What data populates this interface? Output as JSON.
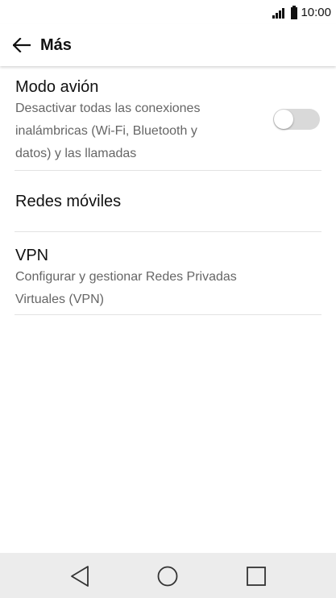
{
  "status_bar": {
    "time": "10:00"
  },
  "app_bar": {
    "title": "Más"
  },
  "settings": {
    "airplane": {
      "title": "Modo avión",
      "subtitle_lines": [
        "Desactivar todas las conexiones",
        "inalámbricas (Wi-Fi, Bluetooth y",
        "datos) y las llamadas"
      ],
      "enabled": false
    },
    "mobile_networks": {
      "title": "Redes móviles"
    },
    "vpn": {
      "title": "VPN",
      "subtitle_lines": [
        "Configurar y gestionar Redes Privadas",
        "Virtuales (VPN)"
      ]
    }
  },
  "colors": {
    "toggle_off": "#d9d9d9",
    "subtitle_text": "#666666",
    "nav_bar": "#ececec"
  },
  "icons": {
    "back": "arrow-left-icon",
    "nav_back": "triangle-back-icon",
    "nav_home": "circle-home-icon",
    "nav_recent": "square-recent-icon"
  }
}
